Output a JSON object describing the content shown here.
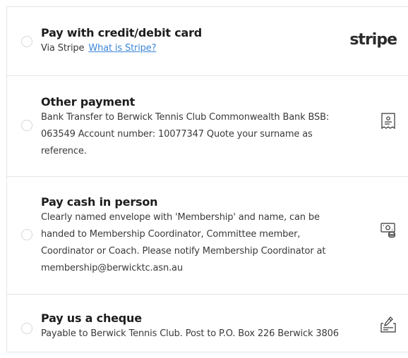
{
  "payment_options": [
    {
      "title": "Pay with credit/debit card",
      "via_text": "Via Stripe",
      "link_text": "What is Stripe?",
      "logo_text": "stripe",
      "selected": false
    },
    {
      "title": "Other payment",
      "description_lines": [
        "Bank Transfer to Berwick Tennis Club Commonwealth Bank BSB:",
        "063549 Account number: 10077347 Quote your surname as",
        "reference."
      ],
      "icon": "receipt-icon",
      "selected": false
    },
    {
      "title": "Pay cash in person",
      "description_lines": [
        "Clearly named envelope with 'Membership' and name, can be",
        "handed to Membership Coordinator, Committee member,",
        "Coordinator or Coach. Please notify Membership Coordinator at",
        "membership@berwicktc.asn.au"
      ],
      "icon": "cash-icon",
      "selected": false
    },
    {
      "title": "Pay us a cheque",
      "description_lines": [
        "Payable to Berwick Tennis Club. Post to P.O. Box 226 Berwick 3806"
      ],
      "icon": "cheque-icon",
      "selected": false
    }
  ],
  "colors": {
    "link": "#3b86d8",
    "border": "#e4e4e4",
    "title": "#1d1d1d",
    "text": "#3a3a3a"
  }
}
